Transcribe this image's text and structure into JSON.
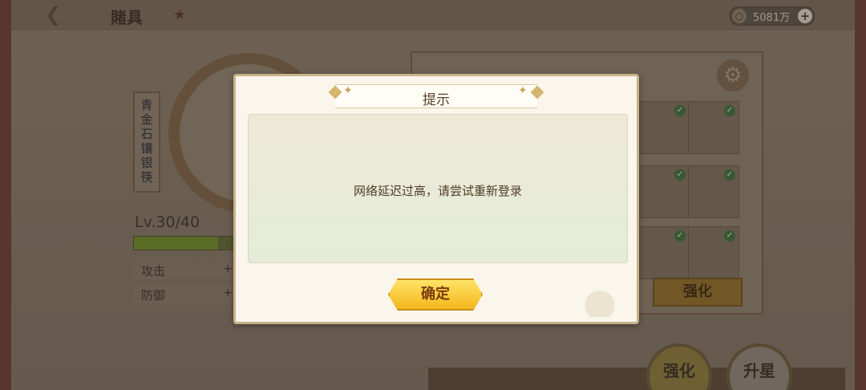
{
  "topbar": {
    "back_icon": "back-arrow-icon",
    "title": "賭具",
    "currency_amount": "5081万",
    "plus_label": "+"
  },
  "character": {
    "name": "青金石镶银筷",
    "level_text": "Lv.30/40",
    "level_fraction": 0.75,
    "stats": [
      {
        "label": "攻击",
        "plus": "+"
      },
      {
        "label": "防御",
        "plus": "+"
      }
    ]
  },
  "panel": {
    "enhance_label": "强化"
  },
  "bottom_buttons": [
    {
      "label": "强化"
    },
    {
      "label": "升星"
    }
  ],
  "dialog": {
    "title": "提示",
    "message": "网络延迟过高，请尝试重新登录",
    "confirm_label": "确定"
  }
}
